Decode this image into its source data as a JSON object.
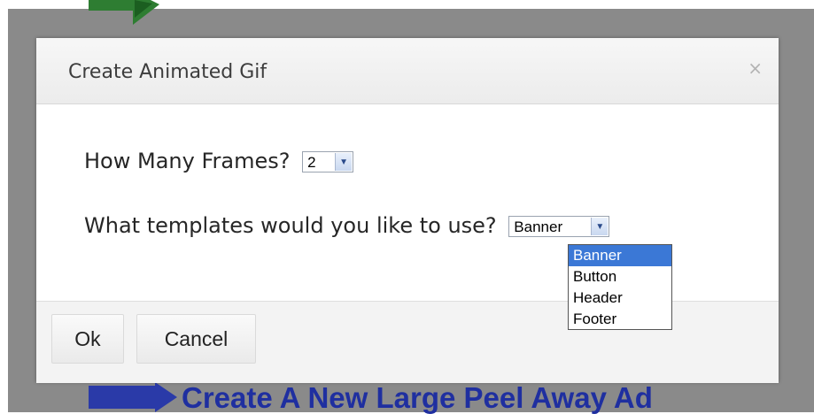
{
  "dialog": {
    "title": "Create Animated Gif",
    "close_symbol": "×",
    "frames_label": "How Many Frames?",
    "frames_value": "2",
    "templates_label": "What templates would you like to use?",
    "templates_value": "Banner",
    "template_options": [
      "Banner",
      "Button",
      "Header",
      "Footer"
    ],
    "ok_label": "Ok",
    "cancel_label": "Cancel"
  },
  "background": {
    "banner_text": "Create A New Large Peel Away Ad"
  },
  "colors": {
    "overlay": "#8a8a8a",
    "banner_text": "#1f2fa0",
    "selected_option": "#3b78d6"
  },
  "icons": {
    "close": "close-icon",
    "dropdown": "chevron-down-icon"
  }
}
